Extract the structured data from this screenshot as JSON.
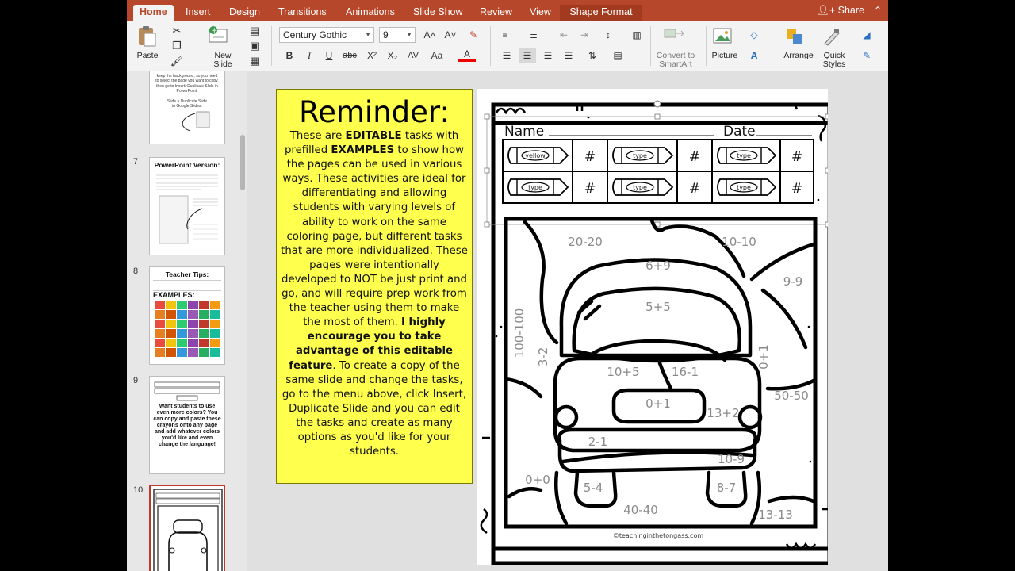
{
  "tabs": [
    "Home",
    "Insert",
    "Design",
    "Transitions",
    "Animations",
    "Slide Show",
    "Review",
    "View",
    "Shape Format"
  ],
  "active_tab": "Home",
  "share_label": "Share",
  "ribbon": {
    "paste_label": "Paste",
    "new_slide_label": [
      "New",
      "Slide"
    ],
    "font_name": "Century Gothic",
    "font_size": "9",
    "convert_label": [
      "Convert to",
      "SmartArt"
    ],
    "picture_label": "Picture",
    "arrange_label": "Arrange",
    "quick_styles_label": [
      "Quick",
      "Styles"
    ],
    "format_buttons": [
      "B",
      "I",
      "U",
      "abc",
      "X²",
      "X₂",
      "AV",
      "Aa",
      "A"
    ]
  },
  "thumbnails": [
    {
      "num": "",
      "lines": [
        "keep the background, so you need",
        "to select the page you want to copy,",
        "then go to Insert>Duplicate Slide in",
        "PowerPoint.",
        "",
        "Slide > Duplicate Slide",
        "in Google Slides."
      ]
    },
    {
      "num": "7",
      "title": "PowerPoint Version:"
    },
    {
      "num": "8",
      "title": "Teacher Tips:",
      "subtitle": "EXAMPLES:"
    },
    {
      "num": "9",
      "text": "Want students to use even more colors? You can copy and paste these crayons onto any page and add whatever colors you'd like and even change the language!"
    },
    {
      "num": "10"
    }
  ],
  "reminder": {
    "title": "Reminder:",
    "segments": [
      {
        "t": "These are ",
        "b": false
      },
      {
        "t": "EDITABLE",
        "b": true
      },
      {
        "t": " tasks with prefilled ",
        "b": false
      },
      {
        "t": "EXAMPLES",
        "b": true
      },
      {
        "t": " to show how the pages can be used in various ways. These activities are ideal for differentiating and allowing students with varying levels of ability to work on the same coloring page, but different tasks that are more individualized. These pages were intentionally developed to NOT be just print and go, and will require prep work from the teacher using them to make the most of them. ",
        "b": false
      },
      {
        "t": "I highly encourage you to take advantage of this editable feature",
        "b": true
      },
      {
        "t": ". To create a copy of the same slide and change the tasks, go to the menu above, click Insert, Duplicate Slide and you can edit the tasks and create as many options as you'd like for your students.",
        "b": false
      }
    ]
  },
  "worksheet": {
    "name_label": "Name",
    "date_label": "Date",
    "crayon_labels": [
      "yellow",
      "type",
      "type",
      "type",
      "type",
      "type"
    ],
    "hash": "#",
    "tasks": [
      "20-20",
      "10-10",
      "6+9",
      "9-9",
      "5+5",
      "100-100",
      "3-2",
      "0+1",
      "10+5",
      "16-1",
      "0+1",
      "50-50",
      "13+2",
      "2-1",
      "10-9",
      "0+0",
      "5-4",
      "8-7",
      "40-40",
      "13-13"
    ],
    "copyright": "©teachinginthetongass.com"
  },
  "colors": {
    "accent": "#b7472a",
    "reminder_bg": "#ffff4d"
  }
}
